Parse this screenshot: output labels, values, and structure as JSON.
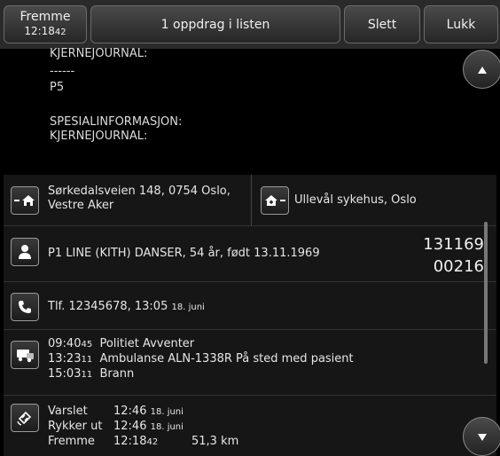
{
  "toolbar": {
    "status_label": "Fremme",
    "status_time_main": "12:18",
    "status_time_sec": "42",
    "title": "1 oppdrag i listen",
    "delete_label": "Slett",
    "close_label": "Lukk"
  },
  "info": {
    "line1": "KJERNEJOURNAL:",
    "line2": "------",
    "line3": "P5",
    "line4": "SPESIALINFORMASJON:",
    "line5": "KJERNEJOURNAL:"
  },
  "address": {
    "from_line1": "Sørkedalsveien 148, 0754 Oslo,",
    "from_line2": "Vestre Aker",
    "to": "Ullevål sykehus, Oslo"
  },
  "patient": {
    "text": "P1 LINE (KITH) DANSER, 54 år, født 13.11.1969",
    "id_part1": "131169",
    "id_part2": "00216"
  },
  "phone": {
    "text": "Tlf. 12345678, 13:05",
    "date": "18. juni"
  },
  "log": [
    {
      "time": "09:40",
      "sec": "45",
      "text": "Politiet Avventer"
    },
    {
      "time": "13:23",
      "sec": "11",
      "text": "Ambulanse ALN-1338R På sted med pasient"
    },
    {
      "time": "15:03",
      "sec": "11",
      "text": "Brann"
    }
  ],
  "timeline": {
    "varslet_label": "Varslet",
    "varslet_time": "12:46",
    "varslet_date": "18. juni",
    "rykker_label": "Rykker ut",
    "rykker_time": "12:46",
    "rykker_date": "18. juni",
    "fremme_label": "Fremme",
    "fremme_time": "12:18",
    "fremme_sec": "42",
    "distance": "51,3 km"
  },
  "icons": {
    "from": "home-arrow-icon",
    "to": "hospital-arrow-icon",
    "person": "person-icon",
    "phone": "phone-icon",
    "vehicle": "vehicle-icon",
    "satellite": "satellite-icon",
    "scroll_up": "chevron-up-icon",
    "scroll_down": "chevron-down-icon"
  },
  "colors": {
    "background": "#000000",
    "row": "#161616",
    "button": "#3a3a3a"
  }
}
